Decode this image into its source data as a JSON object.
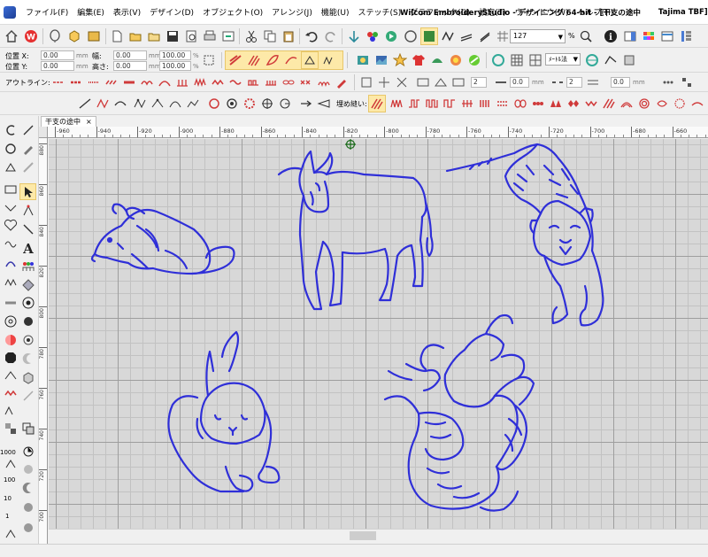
{
  "menubar": {
    "items": [
      "ファイル(F)",
      "編集(E)",
      "表示(V)",
      "デザイン(D)",
      "オブジェクト(O)",
      "アレンジ(J)",
      "機能(U)",
      "ステッチ(S)",
      "グラフィック(G)",
      "設定(T)",
      "ウィンドウ(W)",
      "ヘルプ(H)"
    ],
    "window_title": "Wilcom EmbroideryStudio - デザイニング 64-bit - [干支の途中",
    "user": "Tajima TBF]"
  },
  "toolbar1": {
    "zoom_value": "127",
    "zoom_unit": "%"
  },
  "toolbar2": {
    "pos_x_label": "位置 X:",
    "pos_y_label": "位置 Y:",
    "pos_x_value": "0.00",
    "pos_y_value": "0.00",
    "width_label": "幅:",
    "height_label": "高さ:",
    "width_value": "0.00",
    "height_value": "0.00",
    "scale_w_value": "100.00",
    "scale_h_value": "100.00",
    "unit_mm": "mm",
    "unit_pct": "%",
    "method_combo": "ﾒｰﾄﾙ法"
  },
  "toolbar3": {
    "outline_label": "アウトライン:",
    "spin1": "2",
    "spin2": "0.0",
    "spin3": "2",
    "spin4": "0.0",
    "unit_mm": "mm"
  },
  "toolbar4": {
    "fill_label": "埋め縫い:"
  },
  "document": {
    "tab_label": "干支の途中",
    "close_glyph": "×"
  },
  "rulers": {
    "h_labels": [
      "-960",
      "-940",
      "-920",
      "-900",
      "-880",
      "-860",
      "-840",
      "-820",
      "-800",
      "-780",
      "-760",
      "-740",
      "-720",
      "-700",
      "-680",
      "-660"
    ],
    "v_labels": [
      "880",
      "860",
      "840",
      "820",
      "800",
      "780",
      "760",
      "740",
      "720",
      "700"
    ]
  },
  "toolbox": {
    "labels": {
      "thousand": "1000",
      "hundred": "100",
      "ten": "10",
      "one": "1"
    }
  },
  "colors": {
    "thread": "#2f2fd8",
    "grid_major": "#9e9e9e",
    "grid_minor": "#c2c2c2",
    "canvas": "#d8d8d8",
    "active_tool": "#fde9a8"
  },
  "design_objects": [
    "rat",
    "ox",
    "tiger",
    "rabbit",
    "dragon"
  ]
}
